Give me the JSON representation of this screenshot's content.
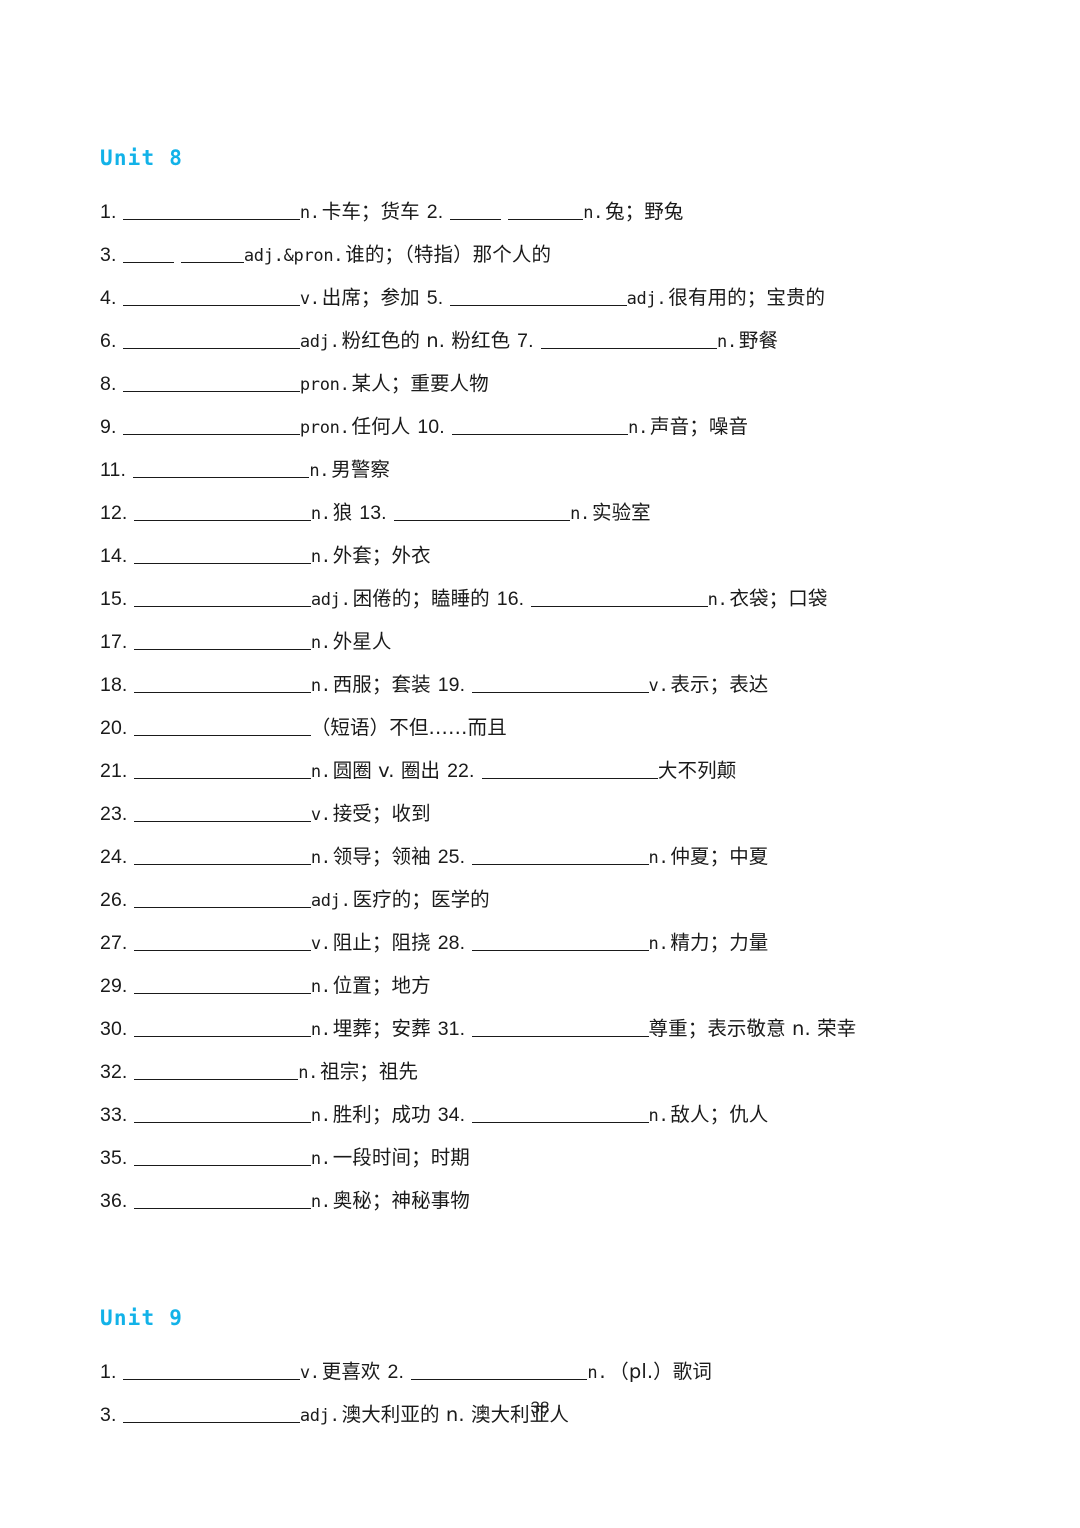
{
  "document": {
    "page_number": "38",
    "heading_color": "#12b2e8",
    "text_color": "#1a1a1a",
    "background_color": "#ffffff"
  },
  "units": [
    {
      "heading": "Unit 8",
      "entries": [
        {
          "num": "1.",
          "blanks": [
            14
          ],
          "pos": "n.",
          "meaning": "卡车；货车"
        },
        {
          "num": "2.",
          "blanks": [
            4,
            6
          ],
          "pos": "n.",
          "meaning": "兔；野兔"
        },
        {
          "num": "3.",
          "blanks": [
            4,
            5
          ],
          "pos": "adj.&pron.",
          "meaning": "谁的；（特指）那个人的"
        },
        {
          "num": "4.",
          "blanks": [
            14
          ],
          "pos": "v.",
          "meaning": "出席；参加"
        },
        {
          "num": "5.",
          "blanks": [
            14
          ],
          "pos": "adj.",
          "meaning": "很有用的；宝贵的"
        },
        {
          "num": "6.",
          "blanks": [
            14
          ],
          "pos": "adj.",
          "meaning": "粉红色的 n. 粉红色"
        },
        {
          "num": "7.",
          "blanks": [
            14
          ],
          "pos": "n.",
          "meaning": "野餐"
        },
        {
          "num": "8.",
          "blanks": [
            14
          ],
          "pos": "pron.",
          "meaning": "某人；重要人物"
        },
        {
          "num": "9.",
          "blanks": [
            14
          ],
          "pos": "pron.",
          "meaning": "任何人"
        },
        {
          "num": "10.",
          "blanks": [
            14
          ],
          "pos": "n.",
          "meaning": "声音；噪音"
        },
        {
          "num": "11.",
          "blanks": [
            14
          ],
          "pos": "n.",
          "meaning": "男警察"
        },
        {
          "num": "12.",
          "blanks": [
            14
          ],
          "pos": "n.",
          "meaning": "狼"
        },
        {
          "num": "13.",
          "blanks": [
            14
          ],
          "pos": "n.",
          "meaning": "实验室"
        },
        {
          "num": "14.",
          "blanks": [
            14
          ],
          "pos": "n.",
          "meaning": "外套；外衣"
        },
        {
          "num": "15.",
          "blanks": [
            14
          ],
          "pos": "adj.",
          "meaning": "困倦的；瞌睡的"
        },
        {
          "num": "16.",
          "blanks": [
            14
          ],
          "pos": "n.",
          "meaning": "衣袋；口袋"
        },
        {
          "num": "17.",
          "blanks": [
            14
          ],
          "pos": "n.",
          "meaning": "外星人"
        },
        {
          "num": "18.",
          "blanks": [
            14
          ],
          "pos": "n.",
          "meaning": "西服；套装"
        },
        {
          "num": "19.",
          "blanks": [
            14
          ],
          "pos": "v.",
          "meaning": "表示；表达"
        },
        {
          "num": "20.",
          "blanks": [
            14
          ],
          "pos": "",
          "meaning": "（短语）不但……而且"
        },
        {
          "num": "21.",
          "blanks": [
            14
          ],
          "pos": "n.",
          "meaning": "圆圈 v. 圈出"
        },
        {
          "num": "22.",
          "blanks": [
            14
          ],
          "pos": "",
          "meaning": "大不列颠"
        },
        {
          "num": "23.",
          "blanks": [
            14
          ],
          "pos": "v.",
          "meaning": "接受；收到"
        },
        {
          "num": "24.",
          "blanks": [
            14
          ],
          "pos": "n.",
          "meaning": "领导；领袖"
        },
        {
          "num": "25.",
          "blanks": [
            14
          ],
          "pos": "n.",
          "meaning": "仲夏；中夏"
        },
        {
          "num": "26.",
          "blanks": [
            14
          ],
          "pos": "adj.",
          "meaning": "医疗的；医学的"
        },
        {
          "num": "27.",
          "blanks": [
            14
          ],
          "pos": "v.",
          "meaning": "阻止；阻挠"
        },
        {
          "num": "28.",
          "blanks": [
            14
          ],
          "pos": "n.",
          "meaning": "精力；力量"
        },
        {
          "num": "29.",
          "blanks": [
            14
          ],
          "pos": "n.",
          "meaning": "位置；地方"
        },
        {
          "num": "30.",
          "blanks": [
            14
          ],
          "pos": "n.",
          "meaning": "埋葬；安葬"
        },
        {
          "num": "31.",
          "blanks": [
            14
          ],
          "pos": "",
          "meaning": "尊重；表示敬意 n. 荣幸"
        },
        {
          "num": "32.",
          "blanks": [
            13
          ],
          "pos": "n.",
          "meaning": "祖宗；祖先"
        },
        {
          "num": "33.",
          "blanks": [
            14
          ],
          "pos": "n.",
          "meaning": "胜利；成功"
        },
        {
          "num": "34.",
          "blanks": [
            14
          ],
          "pos": "n.",
          "meaning": "敌人；仇人"
        },
        {
          "num": "35.",
          "blanks": [
            14
          ],
          "pos": "n.",
          "meaning": "一段时间；时期"
        },
        {
          "num": "36.",
          "blanks": [
            14
          ],
          "pos": "n.",
          "meaning": "奥秘；神秘事物"
        }
      ],
      "lines": [
        [
          "1.",
          "2."
        ],
        [
          "3."
        ],
        [
          "4.",
          "5."
        ],
        [
          "6.",
          "7."
        ],
        [
          "8."
        ],
        [
          "9.",
          "10."
        ],
        [
          "11."
        ],
        [
          "12.",
          "13."
        ],
        [
          "14."
        ],
        [
          "15.",
          "16."
        ],
        [
          "17."
        ],
        [
          "18.",
          "19."
        ],
        [
          "20."
        ],
        [
          "21.",
          "22."
        ],
        [
          "23."
        ],
        [
          "24.",
          "25."
        ],
        [
          "26."
        ],
        [
          "27.",
          "28."
        ],
        [
          "29."
        ],
        [
          "30.",
          "31."
        ],
        [
          "32."
        ],
        [
          "33.",
          "34."
        ],
        [
          "35."
        ],
        [
          "36."
        ]
      ]
    },
    {
      "heading": "Unit 9",
      "entries": [
        {
          "num": "1.",
          "blanks": [
            14
          ],
          "pos": "v.",
          "meaning": "更喜欢"
        },
        {
          "num": "2.",
          "blanks": [
            14
          ],
          "pos": "n.",
          "meaning": "（pl.）歌词"
        },
        {
          "num": "3.",
          "blanks": [
            14
          ],
          "pos": "adj.",
          "meaning": "澳大利亚的 n. 澳大利亚人"
        }
      ],
      "lines": [
        [
          "1.",
          "2."
        ],
        [
          "3."
        ]
      ]
    }
  ]
}
